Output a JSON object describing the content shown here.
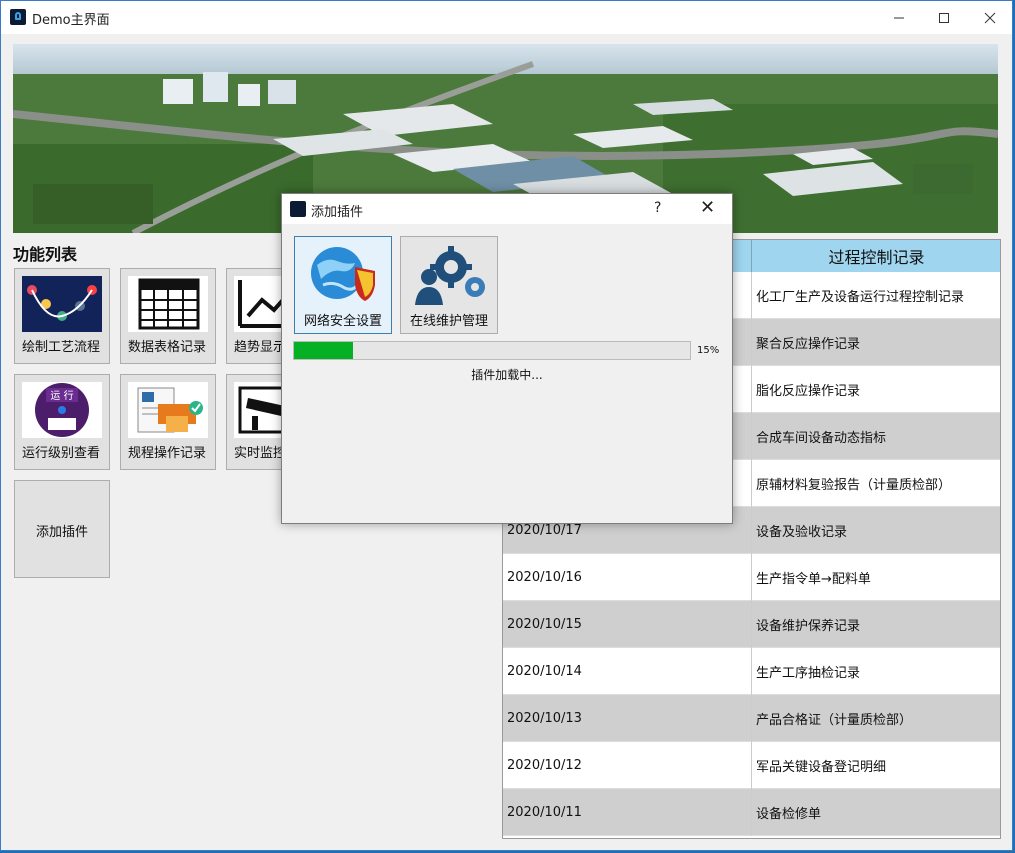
{
  "window": {
    "title": "Demo主界面"
  },
  "sidebar": {
    "title": "功能列表",
    "tiles": [
      {
        "label": "绘制工艺流程",
        "icon": "process-flow-icon"
      },
      {
        "label": "数据表格记录",
        "icon": "data-table-icon"
      },
      {
        "label": "趋势显示",
        "icon": "trend-chart-icon"
      },
      {
        "label": "运行级别查看",
        "icon": "run-level-badge-icon"
      },
      {
        "label": "规程操作记录",
        "icon": "procedure-document-icon"
      },
      {
        "label": "实时监控",
        "icon": "surveillance-camera-icon"
      }
    ],
    "add_plugin_label": "添加插件"
  },
  "table": {
    "headers": [
      "",
      "过程控制记录"
    ],
    "rows": [
      {
        "date": "",
        "record": "化工厂生产及设备运行过程控制记录"
      },
      {
        "date": "",
        "record": "聚合反应操作记录"
      },
      {
        "date": "",
        "record": "脂化反应操作记录"
      },
      {
        "date": "",
        "record": "合成车间设备动态指标"
      },
      {
        "date": "",
        "record": "原辅材料复验报告（计量质检部）"
      },
      {
        "date": "2020/10/17",
        "record": "设备及验收记录"
      },
      {
        "date": "2020/10/16",
        "record": "生产指令单→配料单"
      },
      {
        "date": "2020/10/15",
        "record": "设备维护保养记录"
      },
      {
        "date": "2020/10/14",
        "record": "生产工序抽检记录"
      },
      {
        "date": "2020/10/13",
        "record": "产品合格证（计量质检部）"
      },
      {
        "date": "2020/10/12",
        "record": "军品关键设备登记明细"
      },
      {
        "date": "2020/10/11",
        "record": "设备检修单"
      }
    ]
  },
  "dialog": {
    "title": "添加插件",
    "help": "?",
    "close": "✕",
    "plugins": [
      {
        "label": "网络安全设置",
        "icon": "network-security-icon"
      },
      {
        "label": "在线维护管理",
        "icon": "online-maintenance-icon"
      }
    ],
    "progress_percent": 15,
    "progress_text": "15%",
    "status": "插件加载中..."
  }
}
